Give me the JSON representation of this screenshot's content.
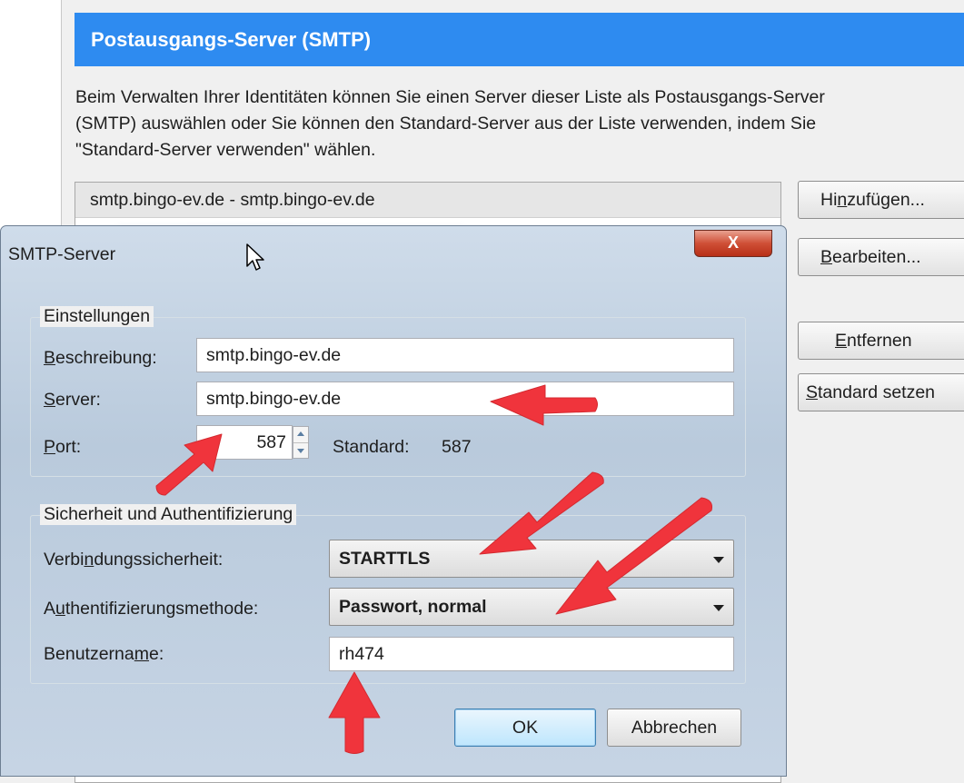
{
  "background": {
    "section_title": "Postausgangs-Server (SMTP)",
    "description": "Beim Verwalten Ihrer Identitäten können Sie einen Server dieser Liste als Postausgangs-Server\n(SMTP) auswählen oder Sie können den Standard-Server aus der Liste verwenden, indem Sie\n\"Standard-Server verwenden\" wählen.",
    "server_list": [
      "smtp.bingo-ev.de - smtp.bingo-ev.de"
    ],
    "buttons": {
      "add": {
        "pre": "Hi",
        "key": "n",
        "post": "zufügen..."
      },
      "edit": {
        "pre": "",
        "key": "B",
        "post": "earbeiten..."
      },
      "remove": {
        "pre": "",
        "key": "E",
        "post": "ntfernen"
      },
      "set_default": {
        "pre": "",
        "key": "S",
        "post": "tandard setzen"
      }
    }
  },
  "dialog": {
    "title": "SMTP-Server",
    "close_glyph": "X",
    "settings_group": {
      "title": "Einstellungen",
      "description": {
        "key": "B",
        "rest": "eschreibung:",
        "value": "smtp.bingo-ev.de"
      },
      "server": {
        "key": "S",
        "rest": "erver:",
        "value": "smtp.bingo-ev.de"
      },
      "port": {
        "key": "P",
        "rest": "ort:",
        "value": "587",
        "default_label": "Standard:",
        "default_value": "587"
      }
    },
    "security_group": {
      "title": "Sicherheit und Authentifizierung",
      "connection_security": {
        "pre": "Verbi",
        "key": "n",
        "post": "dungssicherheit:",
        "value": "STARTTLS"
      },
      "auth_method": {
        "pre": "A",
        "key": "u",
        "post": "thentifizierungsmethode:",
        "value": "Passwort, normal"
      },
      "username": {
        "pre": "Benutzerna",
        "key": "m",
        "post": "e:",
        "value": "rh474"
      }
    },
    "ok_label": "OK",
    "cancel_label": "Abbrechen"
  },
  "colors": {
    "header_blue": "#2e8bf0",
    "arrow_red": "#f0343c"
  }
}
